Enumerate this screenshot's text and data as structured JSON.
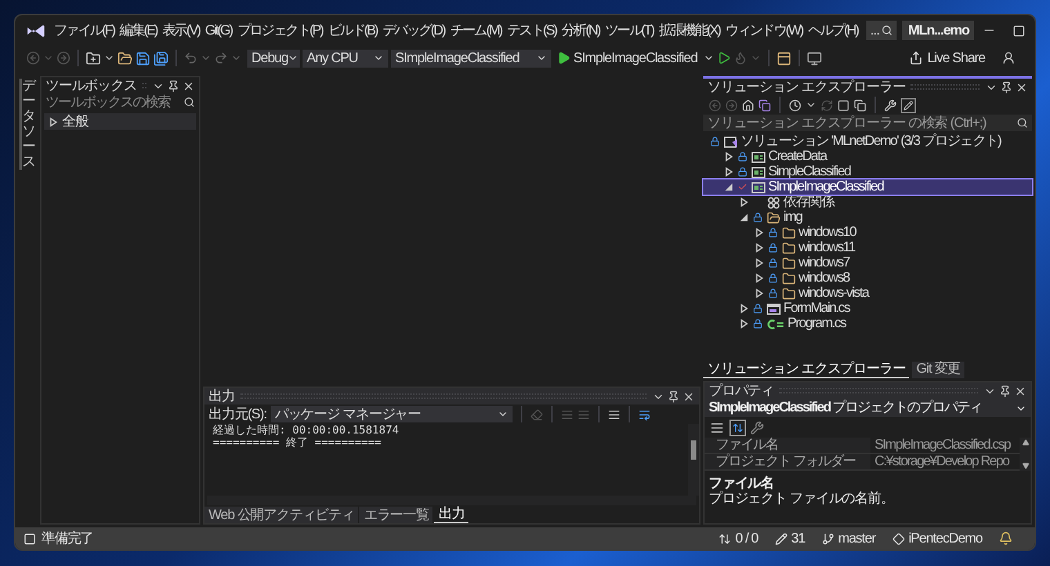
{
  "window": {
    "title": "MLn...emo",
    "search": "..."
  },
  "menu": [
    "ファイル(F)",
    "編集(E)",
    "表示(V)",
    "Git(G)",
    "プロジェクト(P)",
    "ビルド(B)",
    "デバッグ(D)",
    "チーム(M)",
    "テスト(S)",
    "分析(N)",
    "ツール(T)",
    "拡張機能(X)",
    "ウィンドウ(W)",
    "ヘルプ(H)"
  ],
  "toolbar": {
    "configuration": "Debug",
    "platform": "Any CPU",
    "startup_project": "SImpleImageClassified",
    "run_label": "SImpleImageClassified",
    "live_share": "Live Share"
  },
  "side_tabs": [
    "データソース"
  ],
  "toolbox": {
    "title": "ツールボックス",
    "search_placeholder": "ツールボックスの検索",
    "groups": [
      {
        "label": "全般",
        "expanded": false
      }
    ]
  },
  "solution_explorer": {
    "title": "ソリューション エクスプローラー",
    "search_placeholder": "ソリューション エクスプローラー の検索 (Ctrl+;)",
    "tree": [
      {
        "label": "ソリューション 'MLnetDemo' (3/3 プロジェクト)",
        "kind": "solution",
        "locked": true,
        "pending_edit": false,
        "selected": false,
        "children": [
          {
            "label": "CreateData",
            "kind": "project",
            "locked": true,
            "pending_edit": false,
            "expanded": false,
            "selected": false
          },
          {
            "label": "SimpleClassified",
            "kind": "project",
            "locked": true,
            "pending_edit": false,
            "expanded": false,
            "selected": false
          },
          {
            "label": "SImpleImageClassified",
            "kind": "project",
            "locked": false,
            "pending_edit": true,
            "expanded": true,
            "selected": true,
            "children": [
              {
                "label": "依存関係",
                "kind": "dependencies",
                "locked": false,
                "pending_edit": false,
                "expanded": false,
                "selected": false
              },
              {
                "label": "img",
                "kind": "folder",
                "locked": true,
                "pending_edit": false,
                "expanded": true,
                "selected": false,
                "children": [
                  {
                    "label": "windows10",
                    "kind": "folder",
                    "locked": true,
                    "pending_edit": false,
                    "expanded": false,
                    "selected": false
                  },
                  {
                    "label": "windows11",
                    "kind": "folder",
                    "locked": true,
                    "pending_edit": false,
                    "expanded": false,
                    "selected": false
                  },
                  {
                    "label": "windows7",
                    "kind": "folder",
                    "locked": true,
                    "pending_edit": false,
                    "expanded": false,
                    "selected": false
                  },
                  {
                    "label": "windows8",
                    "kind": "folder",
                    "locked": true,
                    "pending_edit": false,
                    "expanded": false,
                    "selected": false
                  },
                  {
                    "label": "windows-vista",
                    "kind": "folder",
                    "locked": true,
                    "pending_edit": false,
                    "expanded": false,
                    "selected": false
                  }
                ]
              },
              {
                "label": "FormMain.cs",
                "kind": "form",
                "locked": true,
                "pending_edit": false,
                "expanded": false,
                "selected": false
              },
              {
                "label": "Program.cs",
                "kind": "csharp",
                "locked": true,
                "pending_edit": false,
                "expanded": false,
                "selected": false
              }
            ]
          }
        ]
      }
    ]
  },
  "right_tabs": [
    {
      "label": "ソリューション エクスプローラー",
      "selected": true
    },
    {
      "label": "Git 変更",
      "selected": false
    }
  ],
  "properties": {
    "title": "プロパティ",
    "object": "**SImpleImageClassified** プロジェクトのプロパティ",
    "views": [
      {
        "kind": "categorized",
        "selected": false
      },
      {
        "kind": "alphabetical",
        "selected": true
      }
    ],
    "rows": [
      {
        "name": "ファイル名",
        "value": "SImpleImageClassified.csp"
      },
      {
        "name": "プロジェクト フォルダー",
        "value": "C:¥storage¥Develop Repo"
      }
    ],
    "description_title": "ファイル名",
    "description": "プロジェクト ファイルの名前。"
  },
  "output": {
    "title": "出力",
    "source_label": "出力元(S):",
    "source": "パッケージ マネージャー",
    "lines": [
      "経過した時間: 00:00:00.1581874",
      "========== 終了 =========="
    ],
    "tabs": [
      {
        "label": "Web 公開アクティビティ",
        "selected": false
      },
      {
        "label": "エラー一覧",
        "selected": false
      },
      {
        "label": "出力",
        "selected": true
      }
    ]
  },
  "status_bar": {
    "message": "準備完了",
    "changes": "0 / 0",
    "edits": "31",
    "branch": "master",
    "repository": "iPentecDemo"
  }
}
